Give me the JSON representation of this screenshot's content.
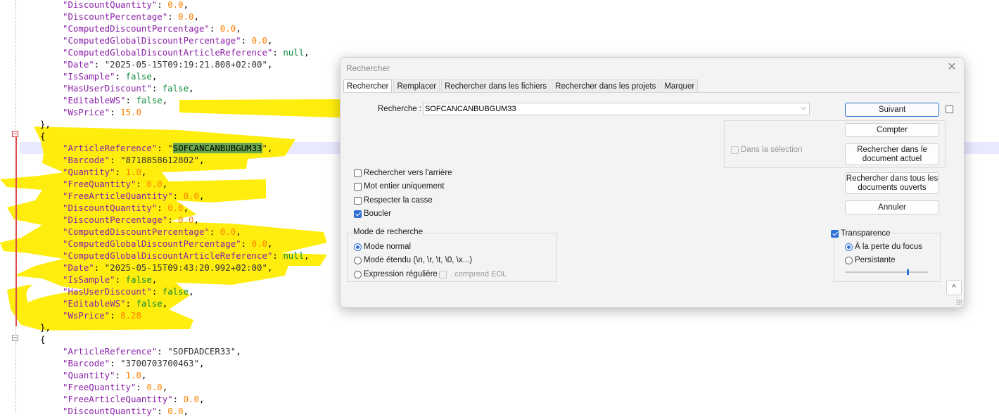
{
  "editor": {
    "lines": [
      {
        "key": "\"DiscountQuantity\"",
        "val": "0.0",
        "vt": "n",
        "tail": ","
      },
      {
        "key": "\"DiscountPercentage\"",
        "val": "0.0",
        "vt": "n",
        "tail": ","
      },
      {
        "key": "\"ComputedDiscountPercentage\"",
        "val": "0.0",
        "vt": "n",
        "tail": ","
      },
      {
        "key": "\"ComputedGlobalDiscountPercentage\"",
        "val": "0.0",
        "vt": "n",
        "tail": ","
      },
      {
        "key": "\"ComputedGlobalDiscountArticleReference\"",
        "val": "null",
        "vt": "b",
        "tail": ","
      },
      {
        "key": "\"Date\"",
        "val": "\"2025-05-15T09:19:21.808+02:00\"",
        "vt": "s",
        "tail": ","
      },
      {
        "key": "\"IsSample\"",
        "val": "false",
        "vt": "b",
        "tail": ","
      },
      {
        "key": "\"HasUserDiscount\"",
        "val": "false",
        "vt": "b",
        "tail": ","
      },
      {
        "key": "\"EditableWS\"",
        "val": "false",
        "vt": "b",
        "tail": ","
      },
      {
        "key": "\"WsPrice\"",
        "val": "15.0",
        "vt": "n",
        "tail": ""
      },
      {
        "raw": "},"
      },
      {
        "raw": "{"
      },
      {
        "key": "\"ArticleReference\"",
        "val": "\"SOFCANCANBUBGUM33\"",
        "vt": "s",
        "tail": ",",
        "hit": "SOFCANCANBUBGUM33"
      },
      {
        "key": "\"Barcode\"",
        "val": "\"8718858612802\"",
        "vt": "s",
        "tail": ","
      },
      {
        "key": "\"Quantity\"",
        "val": "1.0",
        "vt": "n",
        "tail": ","
      },
      {
        "key": "\"FreeQuantity\"",
        "val": "0.0",
        "vt": "n",
        "tail": ","
      },
      {
        "key": "\"FreeArticleQuantity\"",
        "val": "0.0",
        "vt": "n",
        "tail": ","
      },
      {
        "key": "\"DiscountQuantity\"",
        "val": "0.0",
        "vt": "n",
        "tail": ","
      },
      {
        "key": "\"DiscountPercentage\"",
        "val": "0.0",
        "vt": "n",
        "tail": ","
      },
      {
        "key": "\"ComputedDiscountPercentage\"",
        "val": "0.0",
        "vt": "n",
        "tail": ","
      },
      {
        "key": "\"ComputedGlobalDiscountPercentage\"",
        "val": "0.0",
        "vt": "n",
        "tail": ","
      },
      {
        "key": "\"ComputedGlobalDiscountArticleReference\"",
        "val": "null",
        "vt": "b",
        "tail": ","
      },
      {
        "key": "\"Date\"",
        "val": "\"2025-05-15T09:43:20.992+02:00\"",
        "vt": "s",
        "tail": ","
      },
      {
        "key": "\"IsSample\"",
        "val": "false",
        "vt": "b",
        "tail": ","
      },
      {
        "key": "\"HasUserDiscount\"",
        "val": "false",
        "vt": "b",
        "tail": ","
      },
      {
        "key": "\"EditableWS\"",
        "val": "false",
        "vt": "b",
        "tail": ","
      },
      {
        "key": "\"WsPrice\"",
        "val": "8.28",
        "vt": "n",
        "tail": ""
      },
      {
        "raw": "},"
      },
      {
        "raw": "{"
      },
      {
        "key": "\"ArticleReference\"",
        "val": "\"SOFDADCER33\"",
        "vt": "s",
        "tail": ","
      },
      {
        "key": "\"Barcode\"",
        "val": "\"3700703700463\"",
        "vt": "s",
        "tail": ","
      },
      {
        "key": "\"Quantity\"",
        "val": "1.0",
        "vt": "n",
        "tail": ","
      },
      {
        "key": "\"FreeQuantity\"",
        "val": "0.0",
        "vt": "n",
        "tail": ","
      },
      {
        "key": "\"FreeArticleQuantity\"",
        "val": "0.0",
        "vt": "n",
        "tail": ","
      },
      {
        "key": "\"DiscountQuantity\"",
        "val": "0.0",
        "vt": "n",
        "tail": ","
      }
    ]
  },
  "dialog": {
    "title": "Rechercher",
    "close_glyph": "✕",
    "tabs": [
      "Rechercher",
      "Remplacer",
      "Rechercher dans les fichiers",
      "Rechercher dans les projets",
      "Marquer"
    ],
    "search_label": "Recherche :",
    "search_value": "SOFCANCANBUBGUM33",
    "combo_arrow": "⌵",
    "buttons": {
      "next": "Suivant",
      "count": "Compter",
      "find_in_current": "Rechercher dans le document actuel",
      "find_in_all": "Rechercher dans tous les documents ouverts",
      "cancel": "Annuler"
    },
    "in_selection": "Dans la sélection",
    "options": {
      "backward": "Rechercher vers l'arrière",
      "whole_word": "Mot entier uniquement",
      "match_case": "Respecter la casse",
      "wrap": "Boucler"
    },
    "search_mode": {
      "title": "Mode de recherche",
      "normal": "Mode normal",
      "extended": "Mode étendu (\\n, \\r, \\t, \\0, \\x...)",
      "regex": "Expression régulière",
      "eol": ". comprend EOL"
    },
    "transparency": {
      "title": "Transparence",
      "on_focus_loss": "À la perte du focus",
      "persistent": "Persistante",
      "level": 0.75
    },
    "collapse_glyph": "^"
  }
}
